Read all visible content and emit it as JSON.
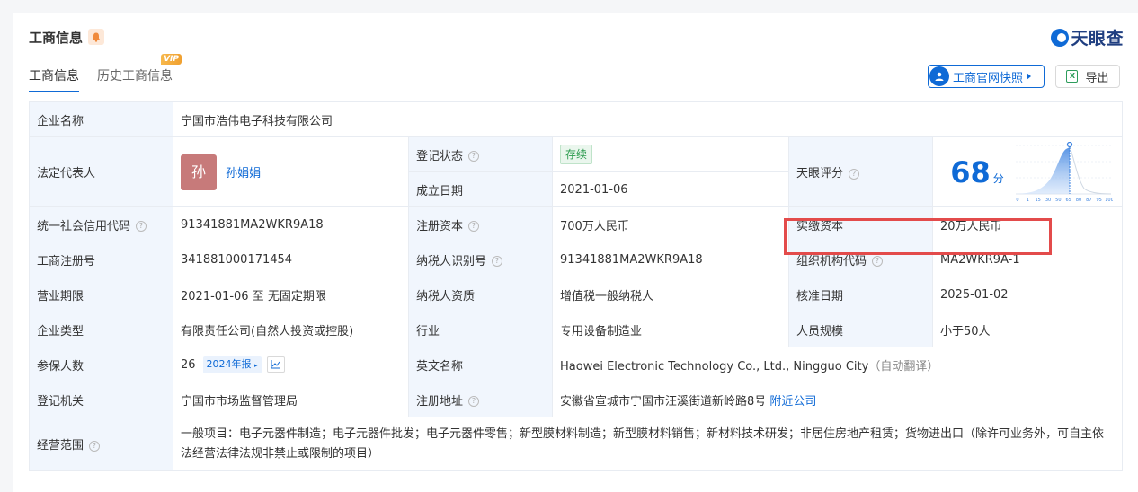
{
  "header": {
    "title": "工商信息",
    "brand": "天眼查",
    "tabs": [
      {
        "label": "工商信息",
        "active": true
      },
      {
        "label": "历史工商信息",
        "badge": "VIP"
      }
    ],
    "snapshot_button": "工商官网快照",
    "export_button": "导出"
  },
  "info": {
    "company_name": {
      "label": "企业名称",
      "value": "宁国市浩伟电子科技有限公司"
    },
    "legal_rep": {
      "label": "法定代表人",
      "avatar_char": "孙",
      "name": "孙娟娟"
    },
    "reg_status": {
      "label": "登记状态",
      "value": "存续"
    },
    "established": {
      "label": "成立日期",
      "value": "2021-01-06"
    },
    "score": {
      "label": "天眼评分",
      "value": "68",
      "unit": "分",
      "axis_ticks": [
        "0",
        "1",
        "15",
        "30",
        "50",
        "65",
        "80",
        "87",
        "95",
        "100"
      ]
    },
    "credit_code": {
      "label": "统一社会信用代码",
      "value": "91341881MA2WKR9A18"
    },
    "reg_capital": {
      "label": "注册资本",
      "value": "700万人民币"
    },
    "paid_capital": {
      "label": "实缴资本",
      "value": "20万人民币"
    },
    "reg_no": {
      "label": "工商注册号",
      "value": "341881000171454"
    },
    "taxpayer_id": {
      "label": "纳税人识别号",
      "value": "91341881MA2WKR9A18"
    },
    "org_code": {
      "label": "组织机构代码",
      "value": "MA2WKR9A-1"
    },
    "term": {
      "label": "营业期限",
      "value": "2021-01-06 至 无固定期限"
    },
    "taxpayer_qual": {
      "label": "纳税人资质",
      "value": "增值税一般纳税人"
    },
    "approval_date": {
      "label": "核准日期",
      "value": "2025-01-02"
    },
    "company_type": {
      "label": "企业类型",
      "value": "有限责任公司(自然人投资或控股)"
    },
    "industry": {
      "label": "行业",
      "value": "专用设备制造业"
    },
    "staff_size": {
      "label": "人员规模",
      "value": "小于50人"
    },
    "insured": {
      "label": "参保人数",
      "value": "26",
      "report": "2024年报"
    },
    "english_name": {
      "label": "英文名称",
      "value": "Haowei Electronic Technology Co., Ltd., Ningguo City",
      "note": "（自动翻译）"
    },
    "authority": {
      "label": "登记机关",
      "value": "宁国市市场监督管理局"
    },
    "address": {
      "label": "注册地址",
      "value": "安徽省宣城市宁国市汪溪街道新岭路8号",
      "nearby": "附近公司"
    },
    "scope": {
      "label": "经营范围",
      "value": "一般项目：电子元器件制造；电子元器件批发；电子元器件零售；新型膜材料制造；新型膜材料销售；新材料技术研发；非居住房地产租赁；货物进出口（除许可业务外，可自主依法经营法律法规非禁止或限制的项目）"
    }
  },
  "colors": {
    "accent": "#0f6ad6",
    "label_bg": "#f1f6fd",
    "highlight": "#e34b4b",
    "status_green": "#2c9b4e"
  }
}
